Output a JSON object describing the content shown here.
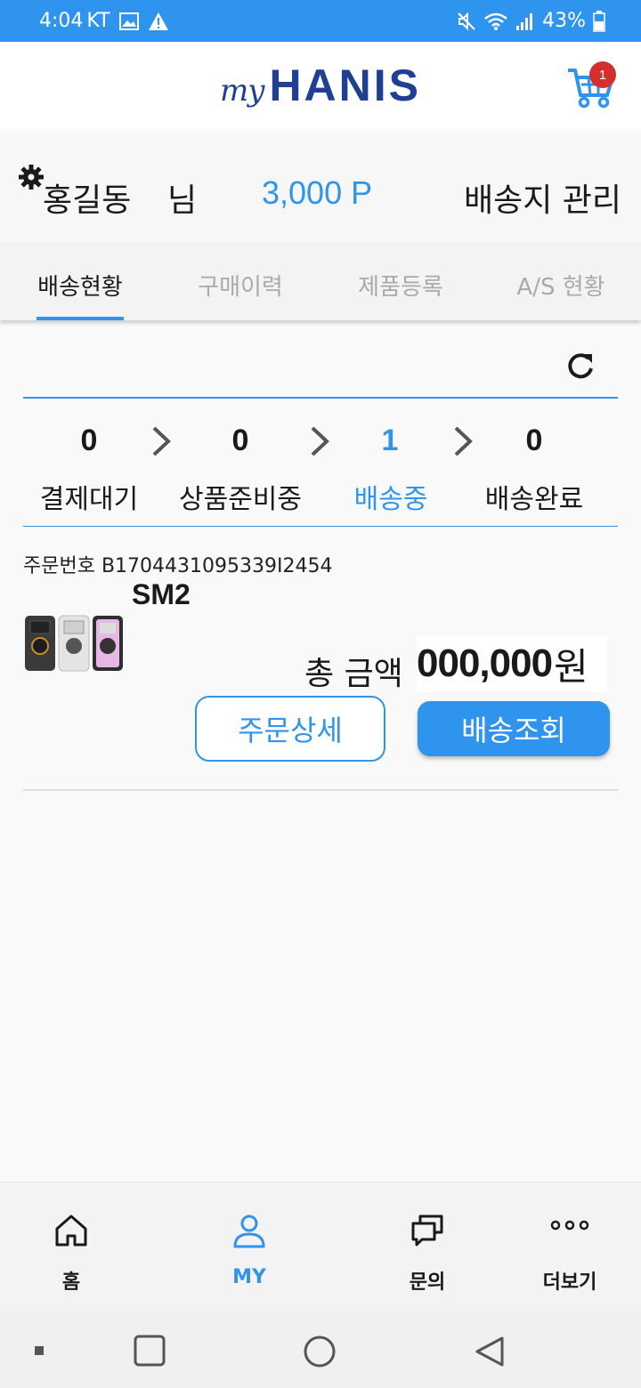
{
  "status_bar": {
    "time": "4:04",
    "carrier": "KT",
    "battery": "43%"
  },
  "header": {
    "logo_my": "my",
    "logo_brand": "HANIS",
    "cart_count": "1"
  },
  "profile": {
    "name": "홍길동",
    "honorific": "님",
    "points": "3,000 P",
    "address_link": "배송지 관리"
  },
  "tabs": [
    {
      "label": "배송현황",
      "active": true
    },
    {
      "label": "구매이력",
      "active": false
    },
    {
      "label": "제품등록",
      "active": false
    },
    {
      "label": "A/S 현황",
      "active": false
    }
  ],
  "steps": [
    {
      "count": "0",
      "label": "결제대기"
    },
    {
      "count": "0",
      "label": "상품준비중"
    },
    {
      "count": "1",
      "label": "배송중",
      "active": true
    },
    {
      "count": "0",
      "label": "배송완료"
    }
  ],
  "order": {
    "number": "주문번호 B17044310953​39I2454",
    "product": "SM2",
    "total_label": "총 금액",
    "total_value": "000,000",
    "total_unit": "원",
    "detail_button": "주문상세",
    "track_button": "배송조회"
  },
  "bottom_nav": [
    {
      "label": "홈",
      "icon": "home-icon"
    },
    {
      "label": "MY",
      "icon": "person-icon",
      "active": true
    },
    {
      "label": "문의",
      "icon": "chat-icon"
    },
    {
      "label": "더보기",
      "icon": "more-icon"
    }
  ],
  "colors": {
    "accent": "#2f94ee",
    "brand": "#1e3f93",
    "badge": "#d32f2f"
  }
}
